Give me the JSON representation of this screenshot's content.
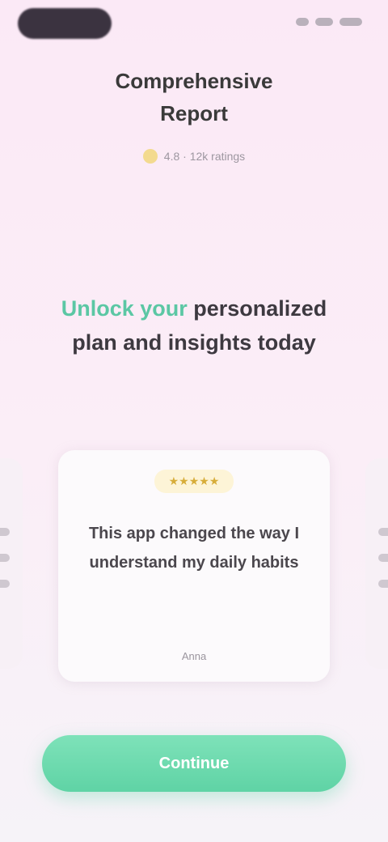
{
  "header": {
    "title": "Comprehensive Report",
    "subtitle": "4.8 · 12k ratings"
  },
  "hero": {
    "accent": "Unlock your",
    "rest": "personalized plan and insights today"
  },
  "card": {
    "badge": "★★★★★",
    "text": "This app changed the way I understand my daily habits",
    "author": "Anna"
  },
  "cta": {
    "label": "Continue"
  },
  "colors": {
    "accent": "#5bc7a4",
    "cta": "#6fdcaf",
    "badge": "#d7ad3a"
  }
}
